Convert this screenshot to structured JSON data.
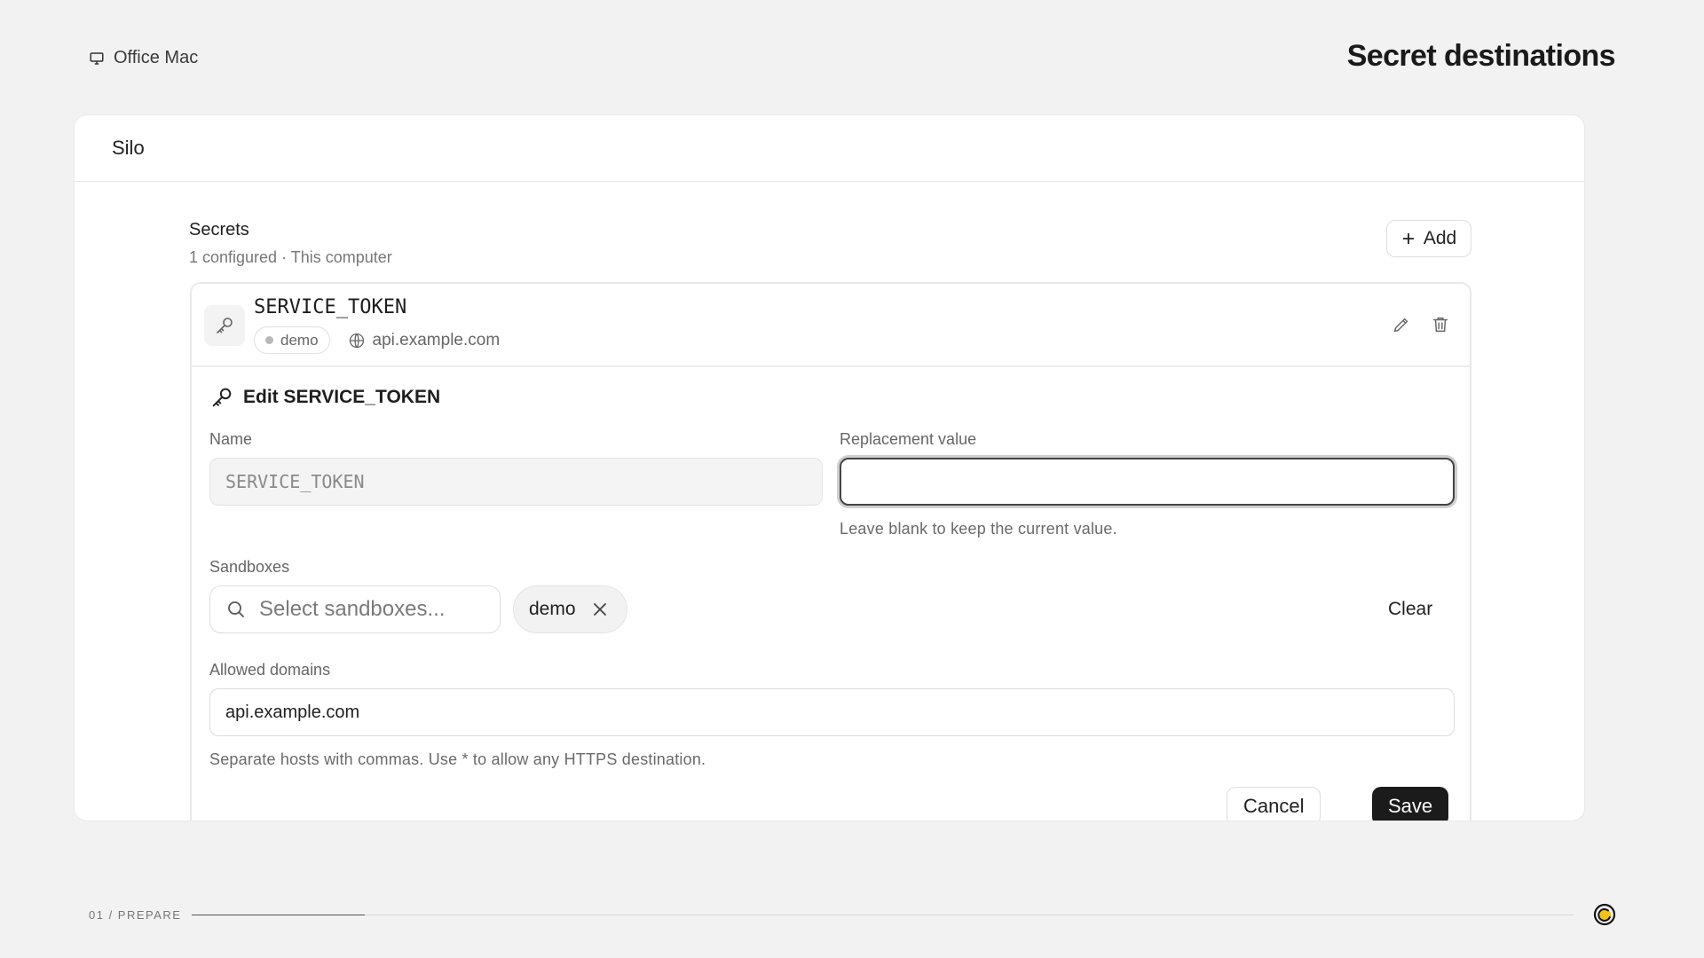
{
  "device": {
    "name": "Office Mac",
    "icon": "monitor-icon"
  },
  "page": {
    "title": "Secret destinations"
  },
  "window": {
    "title": "Silo"
  },
  "secrets_section": {
    "title": "Secrets",
    "subtitle": "1 configured · This computer",
    "add_label": "Add"
  },
  "secret": {
    "name": "SERVICE_TOKEN",
    "sandbox_badge": "demo",
    "domain": "api.example.com"
  },
  "edit_form": {
    "title": "Edit SERVICE_TOKEN",
    "name_label": "Name",
    "name_value": "SERVICE_TOKEN",
    "replacement_label": "Replacement value",
    "replacement_value": "",
    "replacement_hint": "Leave blank to keep the current value.",
    "sandboxes_label": "Sandboxes",
    "sandboxes_placeholder": "Select sandboxes...",
    "selected_sandboxes": [
      "demo"
    ],
    "clear_label": "Clear",
    "domains_label": "Allowed domains",
    "domains_value": "api.example.com",
    "domains_hint": "Separate hosts with commas. Use * to allow any HTTPS destination.",
    "cancel_label": "Cancel",
    "save_label": "Save"
  },
  "footer": {
    "step_label": "01 / PREPARE",
    "progress": 0.125
  },
  "colors": {
    "primary_button": "#1b1b1b",
    "background": "#f2f2f2"
  }
}
